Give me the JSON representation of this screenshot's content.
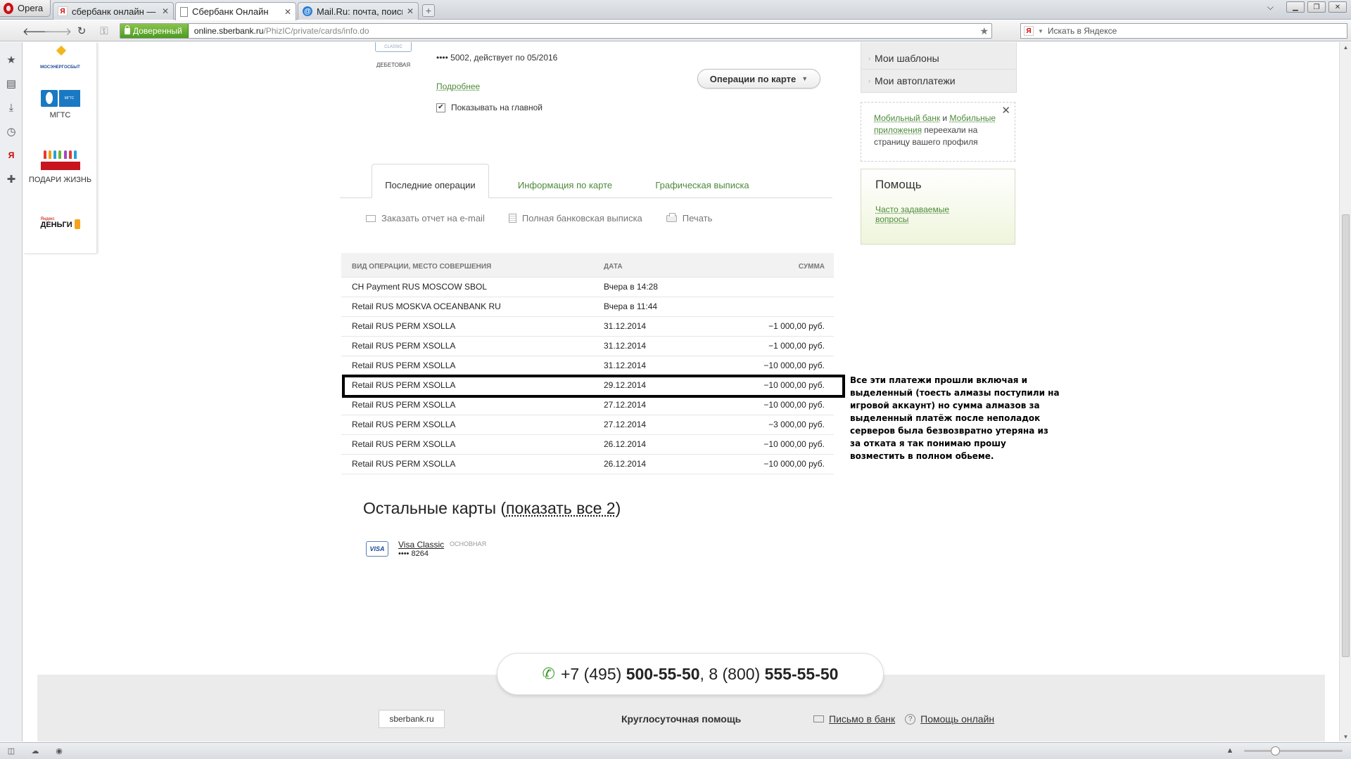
{
  "browser": {
    "menu_label": "Opera",
    "tabs": [
      {
        "title": "сбербанк онлайн — Я..."
      },
      {
        "title": "Сбербанк Онлайн"
      },
      {
        "title": "Mail.Ru: почта, поиск ..."
      }
    ],
    "trust_label": "Доверенный",
    "url_host": "online.sberbank.ru",
    "url_path": "/PhizIC/private/cards/info.do",
    "search_placeholder": "Искать в Яндексе"
  },
  "partners": [
    {
      "label": "МОСЭНЕРГОСБЫТ",
      "caption": ""
    },
    {
      "label": "МГТС",
      "caption": "МГТС"
    },
    {
      "label": "ПОДАРИ ЖИЗНЬ",
      "caption": "ПОДАРИ ЖИЗНЬ"
    },
    {
      "label_small": "Яндекс",
      "label": "ДЕНЬГИ"
    }
  ],
  "card": {
    "type_badge": "CLASSIC",
    "kind": "ДЕБЕТОВАЯ",
    "number_line": "•••• 5002, действует по 05/2016",
    "more_link": "Подробнее",
    "operations_button": "Операции по карте",
    "show_on_main": "Показывать на главной",
    "show_on_main_checked": true
  },
  "tabs": [
    {
      "label": "Последние операции",
      "active": true
    },
    {
      "label": "Информация по карте",
      "active": false
    },
    {
      "label": "Графическая выписка",
      "active": false
    }
  ],
  "actions": {
    "email_report": "Заказать отчет на e-mail",
    "full_statement": "Полная банковская выписка",
    "print": "Печать"
  },
  "operations": {
    "columns": [
      "ВИД ОПЕРАЦИИ, МЕСТО СОВЕРШЕНИЯ",
      "ДАТА",
      "СУММА"
    ],
    "rows": [
      {
        "desc": "CH Payment RUS MOSCOW SBOL",
        "date": "Вчера в 14:28",
        "amount": ""
      },
      {
        "desc": "Retail RUS MOSKVA OCEANBANK RU",
        "date": "Вчера в 11:44",
        "amount": ""
      },
      {
        "desc": "Retail RUS PERM XSOLLA",
        "date": "31.12.2014",
        "amount": "−1 000,00 руб."
      },
      {
        "desc": "Retail RUS PERM XSOLLA",
        "date": "31.12.2014",
        "amount": "−1 000,00 руб."
      },
      {
        "desc": "Retail RUS PERM XSOLLA",
        "date": "31.12.2014",
        "amount": "−10 000,00 руб."
      },
      {
        "desc": "Retail RUS PERM XSOLLA",
        "date": "29.12.2014",
        "amount": "−10 000,00 руб."
      },
      {
        "desc": "Retail RUS PERM XSOLLA",
        "date": "27.12.2014",
        "amount": "−10 000,00 руб."
      },
      {
        "desc": "Retail RUS PERM XSOLLA",
        "date": "27.12.2014",
        "amount": "−3 000,00 руб."
      },
      {
        "desc": "Retail RUS PERM XSOLLA",
        "date": "26.12.2014",
        "amount": "−10 000,00 руб."
      },
      {
        "desc": "Retail RUS PERM XSOLLA",
        "date": "26.12.2014",
        "amount": "−10 000,00 руб."
      }
    ]
  },
  "annotation": {
    "text": "Все эти платежи прошли  включая и выделенный  (тоесть алмазы поступили на игровой аккаунт) но сумма алмазов за выделенный платёж после неполадок серверов была безвозвратно утеряна  из за отката я так понимаю прошу возместить в полном обьеме."
  },
  "other_cards": {
    "title_prefix": "Остальные карты (",
    "title_link": "показать все 2",
    "title_suffix": ")",
    "card_name": "Visa Classic",
    "card_tag": "ОСНОВНАЯ",
    "card_number": "•••• 8264",
    "brand": "VISA"
  },
  "sidebar": {
    "menu": [
      "Мои шаблоны",
      "Мои автоплатежи"
    ],
    "mobile_notice": {
      "link1": "Мобильный банк",
      "and": " и ",
      "link2": "Мобильные приложения",
      "rest": " переехали на страницу вашего профиля"
    },
    "help_title": "Помощь",
    "help_link": "Часто задаваемые вопросы"
  },
  "footer": {
    "phone1_prefix": "+7 (495) ",
    "phone1_number": "500-55-50",
    "separator": ", 8 (800) ",
    "phone2_number": "555-55-50",
    "site_button": "sberbank.ru",
    "support": "Круглосуточная помощь",
    "letter_link": "Письмо в банк",
    "help_online": "Помощь онлайн"
  },
  "colors": {
    "link_green": "#4d8a3a",
    "trust_green": "#4b9b22",
    "brand_red": "#cc0f16"
  }
}
